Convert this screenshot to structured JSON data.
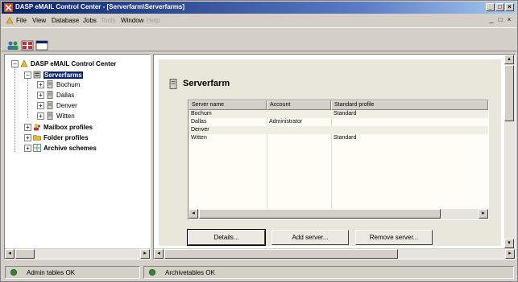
{
  "window": {
    "title": "DASP eMAIL Control Center - [Serverfarm\\Serverfarms]",
    "caption_buttons": [
      "_",
      "□",
      "×"
    ],
    "mdi_buttons": [
      "_",
      "□",
      "×"
    ]
  },
  "menu": {
    "items": [
      {
        "label": "File",
        "enabled": true
      },
      {
        "label": "View",
        "enabled": true
      },
      {
        "label": "Database",
        "enabled": true
      },
      {
        "label": "Jobs",
        "enabled": true
      },
      {
        "label": "Tools",
        "enabled": false
      },
      {
        "label": "Window",
        "enabled": true
      },
      {
        "label": "Help",
        "enabled": false
      }
    ]
  },
  "toolbar": {
    "buttons": [
      "users-icon",
      "grid-icon",
      "window-icon"
    ]
  },
  "tree": {
    "root": "DASP eMAIL Control Center",
    "serverfarms": "Serverfarms",
    "servers": [
      "Bochum",
      "Dallas",
      "Denver",
      "Witten"
    ],
    "mailbox_profiles": "Mailbox profiles",
    "folder_profiles": "Folder profiles",
    "archive_schemes": "Archive schemes"
  },
  "panel": {
    "title": "Serverfarm",
    "columns": [
      "Server name",
      "Account",
      "Standard profile"
    ],
    "rows": [
      [
        "Bochum",
        "",
        "Standard"
      ],
      [
        "Dallas",
        "Administrator",
        ""
      ],
      [
        "Denver",
        "",
        ""
      ],
      [
        "Witten",
        "",
        "Standard"
      ]
    ],
    "buttons": {
      "details": "Details...",
      "add_server": "Add server...",
      "remove_server": "Remove server..."
    }
  },
  "status": {
    "left": "Admin tables OK",
    "right": "Archivetables OK"
  },
  "colors": {
    "titlebar": "#0a246a",
    "selection": "#0a246a",
    "status_ok": "#2e8b2e",
    "folder": "#e8b830"
  }
}
